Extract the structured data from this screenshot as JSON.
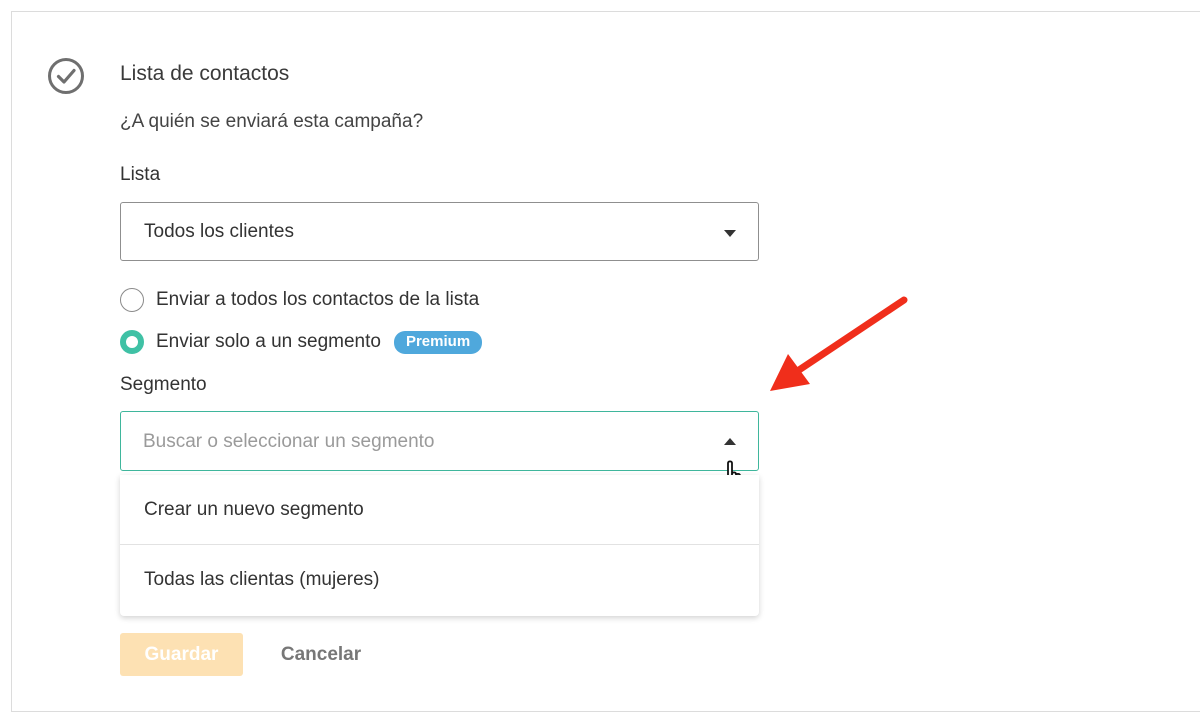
{
  "section": {
    "title": "Lista de contactos",
    "subtitle": "¿A quién se enviará esta campaña?"
  },
  "list_field": {
    "label": "Lista",
    "selected": "Todos los clientes"
  },
  "send_options": [
    {
      "label": "Enviar a todos los contactos de la lista",
      "checked": false
    },
    {
      "label": "Enviar solo a un segmento",
      "checked": true,
      "badge": "Premium"
    }
  ],
  "segment_field": {
    "label": "Segmento",
    "placeholder": "Buscar o seleccionar un segmento",
    "value": "",
    "options": [
      "Crear un nuevo segmento",
      "Todas las clientas (mujeres)"
    ]
  },
  "actions": {
    "save_label": "Guardar",
    "cancel_label": "Cancelar"
  },
  "colors": {
    "accent": "#3fc1a5",
    "badge": "#4fa8dc",
    "save_disabled": "#fde1b3",
    "annotation_arrow": "#f02e1b"
  },
  "icons": {
    "section_status": "check-circle-icon",
    "list_select": "caret-down-icon",
    "segment_toggle": "caret-up-icon",
    "cursor": "hand-pointer-icon",
    "annotation": "red-arrow-icon"
  }
}
